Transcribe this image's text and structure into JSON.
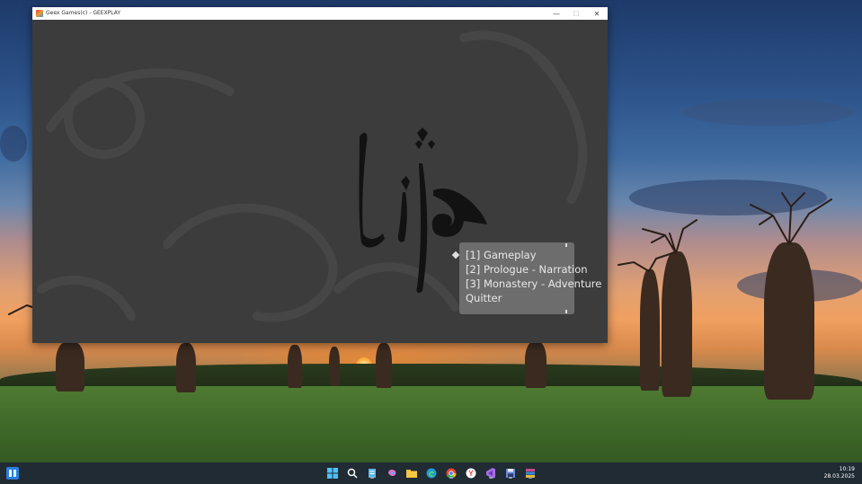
{
  "window": {
    "title": "Geex Games(c) - GEEXPLAY",
    "controls": {
      "minimize": "—",
      "maximize": "☐",
      "close": "✕"
    }
  },
  "game": {
    "logo_text": "Lija",
    "menu": {
      "items": [
        {
          "label": "[1] Gameplay",
          "selected": true
        },
        {
          "label": "[2] Prologue - Narration",
          "selected": false
        },
        {
          "label": "[3] Monastery - Adventure",
          "selected": false
        },
        {
          "label": "Quitter",
          "selected": false
        }
      ]
    }
  },
  "taskbar": {
    "icons": [
      "widgets-icon",
      "start-icon",
      "search-icon",
      "notepad-icon",
      "copilot-icon",
      "file-explorer-icon",
      "edge-icon",
      "chrome-icon",
      "yandex-icon",
      "visual-studio-icon",
      "save-disk-icon",
      "archive-icon"
    ],
    "time": "10:19",
    "date": "28.03.2025"
  },
  "colors": {
    "window_bg": "#3c3c3c",
    "menu_panel": "#969696",
    "menu_text": "#e8e8e8",
    "taskbar": "#202b33"
  }
}
